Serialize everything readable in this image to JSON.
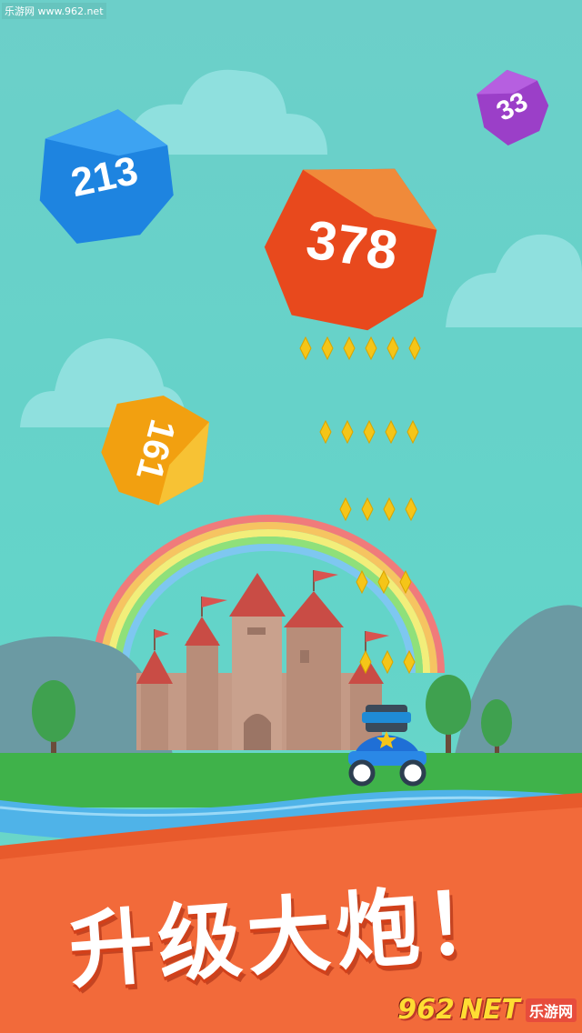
{
  "watermark_top": "乐游网 www.962.net",
  "rocks": [
    {
      "label": "213",
      "color": "#1e84e0"
    },
    {
      "label": "378",
      "color": "#e8491d"
    },
    {
      "label": "33",
      "color": "#9b3fc8"
    },
    {
      "label": "161",
      "color": "#f2a010"
    }
  ],
  "banner": {
    "text": "升级大炮！",
    "color": "#f26a3a"
  },
  "brand": {
    "logo": "962",
    "net": "NET",
    "sub": "乐游网"
  },
  "colors": {
    "sky": "#6ccfc9",
    "grass": "#3fb24a",
    "river": "#4fb3e8",
    "coin": "#f5c518"
  }
}
